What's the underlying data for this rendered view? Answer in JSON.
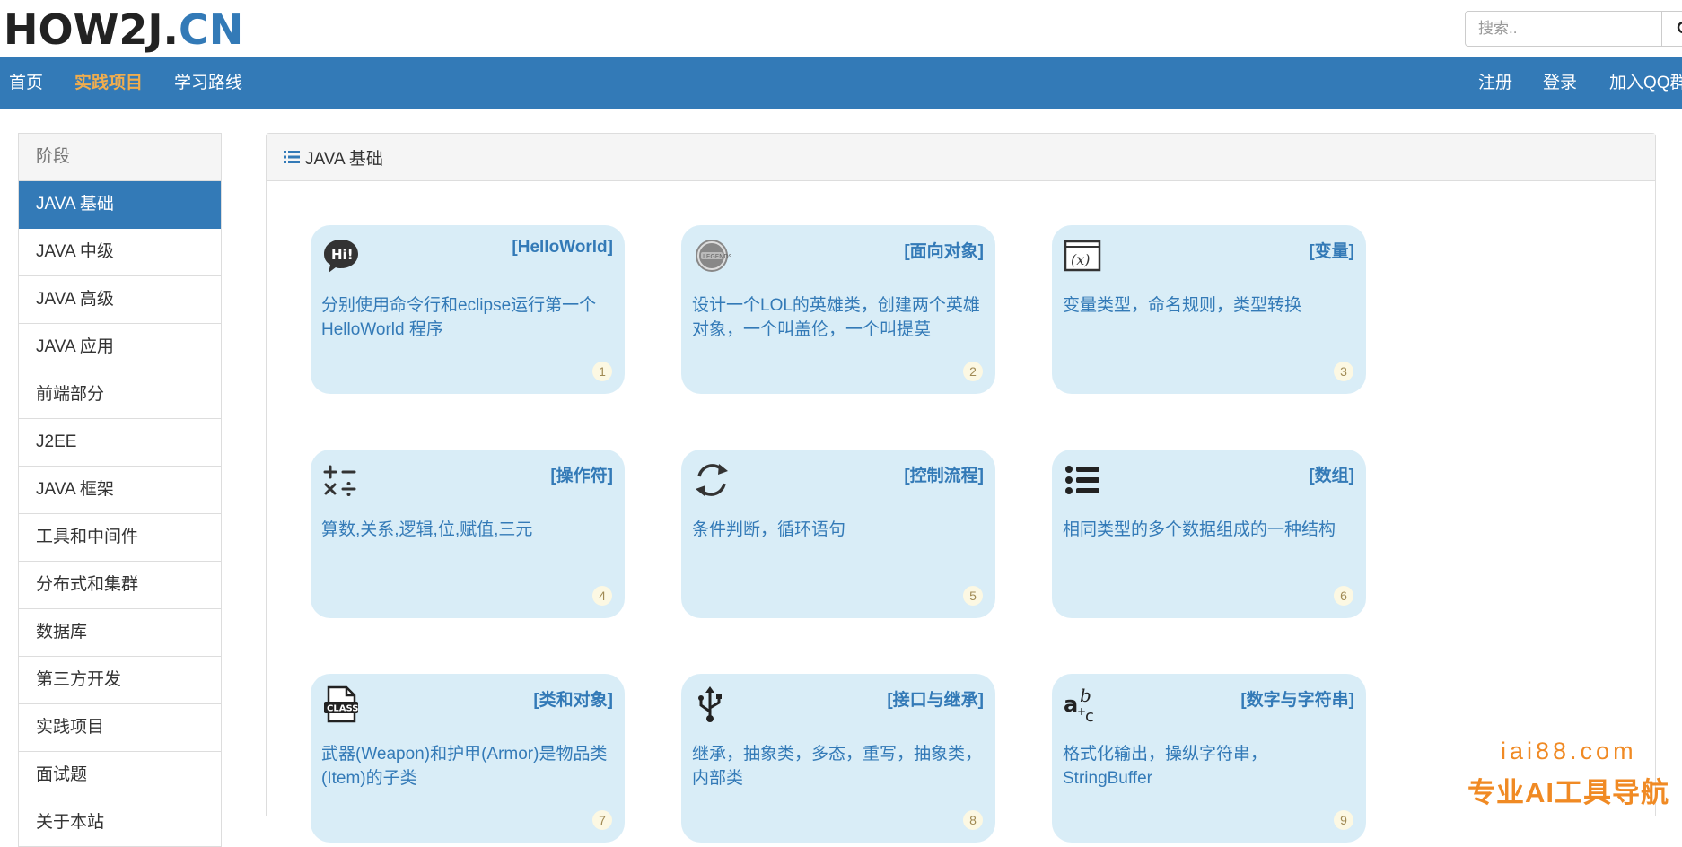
{
  "header": {
    "logo_part1": "HOW2J.",
    "logo_part2": "CN",
    "search_placeholder": "搜索..",
    "search_icon": "search-icon"
  },
  "nav": {
    "left": [
      "首页",
      "实践项目",
      "学习路线"
    ],
    "active": "实践项目",
    "right": [
      "注册",
      "登录",
      "加入QQ群"
    ]
  },
  "sidebar": {
    "heading": "阶段",
    "items": [
      {
        "label": "JAVA 基础",
        "active": true
      },
      {
        "label": "JAVA 中级"
      },
      {
        "label": "JAVA 高级"
      },
      {
        "label": "JAVA 应用"
      },
      {
        "label": "前端部分"
      },
      {
        "label": "J2EE"
      },
      {
        "label": "JAVA 框架"
      },
      {
        "label": "工具和中间件"
      },
      {
        "label": "分布式和集群"
      },
      {
        "label": "数据库"
      },
      {
        "label": "第三方开发"
      },
      {
        "label": "实践项目"
      },
      {
        "label": "面试题"
      },
      {
        "label": "关于本站"
      }
    ]
  },
  "panel": {
    "title": "JAVA 基础",
    "title_icon": "list-icon",
    "cards": [
      {
        "title": "[HelloWorld]",
        "desc": "分别使用命令行和eclipse运行第一个HelloWorld 程序",
        "num": "1",
        "icon": "hi-speech-bubble-icon"
      },
      {
        "title": "[面向对象]",
        "desc": "设计一个LOL的英雄类，创建两个英雄对象，一个叫盖伦，一个叫提莫",
        "num": "2",
        "icon": "lol-emblem-icon"
      },
      {
        "title": "[变量]",
        "desc": "变量类型，命名规则，类型转换",
        "num": "3",
        "icon": "variable-x-icon"
      },
      {
        "title": "[操作符]",
        "desc": "算数,关系,逻辑,位,赋值,三元",
        "num": "4",
        "icon": "math-operators-icon"
      },
      {
        "title": "[控制流程]",
        "desc": "条件判断，循环语句",
        "num": "5",
        "icon": "loop-arrows-icon"
      },
      {
        "title": "[数组]",
        "desc": "相同类型的多个数据组成的一种结构",
        "num": "6",
        "icon": "list-bullets-icon"
      },
      {
        "title": "[类和对象]",
        "desc": "武器(Weapon)和护甲(Armor)是物品类(Item)的子类",
        "num": "7",
        "icon": "class-file-icon"
      },
      {
        "title": "[接口与继承]",
        "desc": "继承，抽象类，多态，重写，抽象类，内部类",
        "num": "8",
        "icon": "usb-icon"
      },
      {
        "title": "[数字与字符串]",
        "desc": "格式化输出，操纵字符串，StringBuffer",
        "num": "9",
        "icon": "abc-text-icon"
      }
    ]
  },
  "watermark": {
    "line1": "iai88.com",
    "line2": "专业AI工具导航"
  }
}
